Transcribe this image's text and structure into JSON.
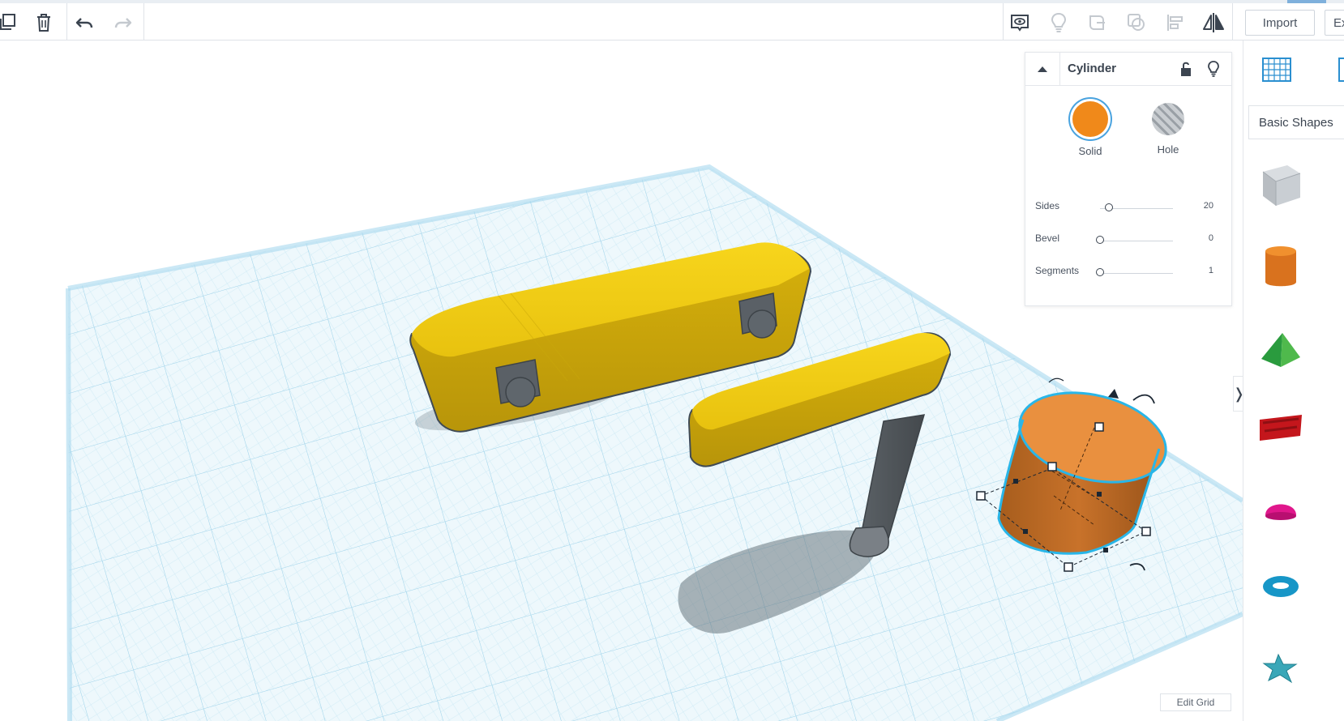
{
  "toolbar": {
    "duplicate_icon": "duplicate-icon",
    "delete_icon": "trash-icon",
    "undo_icon": "undo-icon",
    "redo_icon": "redo-icon",
    "view_icons": [
      "show-all-icon",
      "light-bulb-icon",
      "group-icon",
      "ungroup-icon",
      "align-icon",
      "mirror-icon"
    ],
    "import_label": "Import",
    "export_label": "Ex"
  },
  "inspector": {
    "title": "Cylinder",
    "lock_icon": "lock-icon",
    "visibility_icon": "light-bulb-icon",
    "solid_label": "Solid",
    "hole_label": "Hole",
    "solid_color": "#f0891a",
    "params": [
      {
        "label": "Sides",
        "value": "20",
        "level": 0.13
      },
      {
        "label": "Bevel",
        "value": "0",
        "level": 0.0
      },
      {
        "label": "Segments",
        "value": "1",
        "level": 0.0
      }
    ]
  },
  "shapes_panel": {
    "category": "Basic Shapes",
    "shapes": [
      "box",
      "cylinder",
      "pyramid",
      "text",
      "half-sphere",
      "torus",
      "star"
    ]
  },
  "viewport": {
    "edit_grid_label": "Edit Grid",
    "selected_shape": "cylinder"
  },
  "colors": {
    "workplane": "#e8f4fa",
    "grid_line": "#bfe3f1",
    "selection": "#29b6e8",
    "yellow": "#f1cc18",
    "orange": "#e8892e",
    "gray": "#595e63"
  }
}
